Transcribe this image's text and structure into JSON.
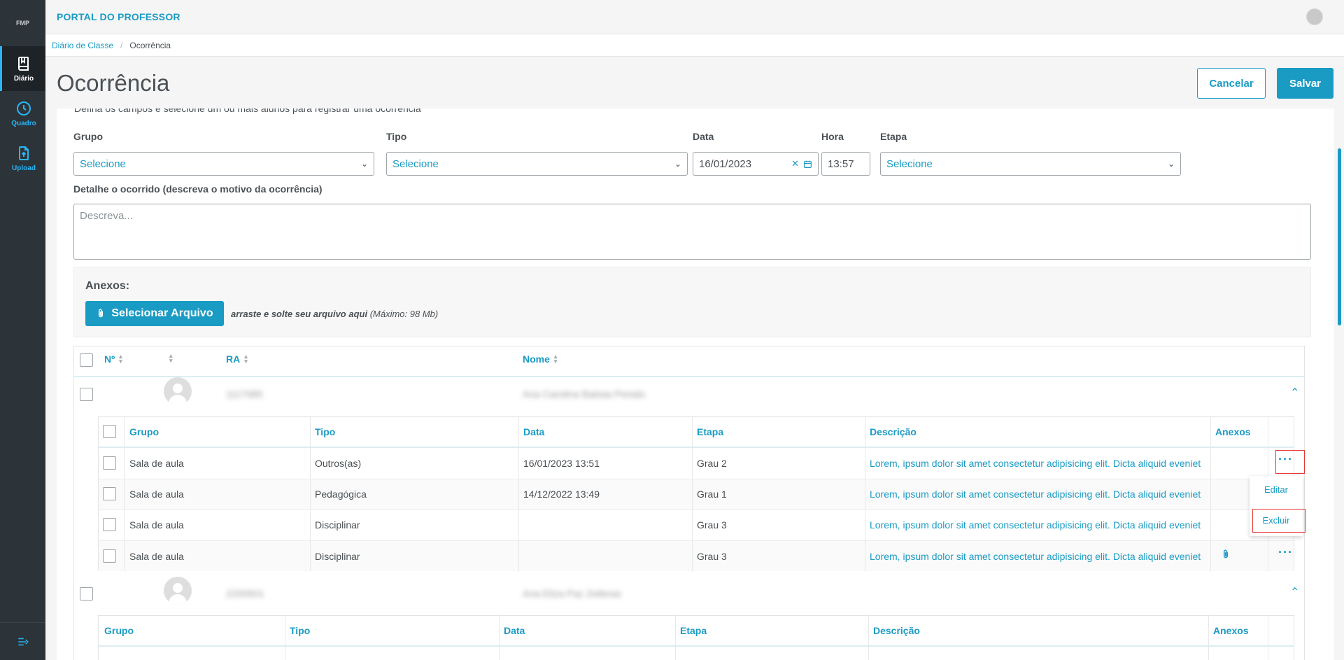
{
  "app": {
    "logo": "FMP",
    "title": "PORTAL DO PROFESSOR"
  },
  "sidebar": {
    "items": [
      {
        "label": "Diário",
        "icon": "book-icon"
      },
      {
        "label": "Quadro",
        "icon": "clock-icon"
      },
      {
        "label": "Upload",
        "icon": "upload-icon"
      }
    ]
  },
  "breadcrumb": {
    "parent": "Diário de Classe",
    "current": "Ocorrência"
  },
  "page": {
    "title": "Ocorrência",
    "cancel_label": "Cancelar",
    "save_label": "Salvar",
    "intro": "Defina os campos e selecione um ou mais alunos para registrar uma ocorrência"
  },
  "form": {
    "grupo_label": "Grupo",
    "grupo_value": "Selecione",
    "tipo_label": "Tipo",
    "tipo_value": "Selecione",
    "data_label": "Data",
    "data_value": "16/01/2023",
    "hora_label": "Hora",
    "hora_value": "13:57",
    "etapa_label": "Etapa",
    "etapa_value": "Selecione",
    "detalhe_label": "Detalhe o ocorrido (descreva o motivo da ocorrência)",
    "detalhe_placeholder": "Descreva..."
  },
  "attachments": {
    "label": "Anexos:",
    "button_label": "Selecionar Arquivo",
    "hint_bold": "arraste e solte seu arquivo aqui",
    "hint_rest": " (Máximo: 98 Mb)"
  },
  "students_table": {
    "headers": {
      "numero": "Nº",
      "ra": "RA",
      "nome": "Nome"
    },
    "students": [
      {
        "ra": "1117085",
        "nome": "Ana Carolina Batista Penido"
      },
      {
        "ra": "2200501",
        "nome": "Ana Eliza Paz Zelleras"
      }
    ]
  },
  "occurrences_table": {
    "headers": {
      "grupo": "Grupo",
      "tipo": "Tipo",
      "data": "Data",
      "etapa": "Etapa",
      "descricao": "Descrição",
      "anexos": "Anexos"
    },
    "rows": [
      {
        "grupo": "Sala de aula",
        "tipo": "Outros(as)",
        "data": "16/01/2023 13:51",
        "etapa": "Grau 2",
        "descricao": "Lorem, ipsum dolor sit amet consectetur adipisicing elit. Dicta aliquid eveniet"
      },
      {
        "grupo": "Sala de aula",
        "tipo": "Pedagógica",
        "data": "14/12/2022 13:49",
        "etapa": "Grau 1",
        "descricao": "Lorem, ipsum dolor sit amet consectetur adipisicing elit. Dicta aliquid eveniet"
      },
      {
        "grupo": "Sala de aula",
        "tipo": "Disciplinar",
        "data": "",
        "etapa": "Grau 3",
        "descricao": "Lorem, ipsum dolor sit amet consectetur adipisicing elit. Dicta aliquid eveniet"
      },
      {
        "grupo": "Sala de aula",
        "tipo": "Disciplinar",
        "data": "",
        "etapa": "Grau 3",
        "descricao": "Lorem, ipsum dolor sit amet consectetur adipisicing elit. Dicta aliquid eveniet"
      }
    ]
  },
  "row_menu": {
    "edit_label": "Editar",
    "delete_label": "Excluir"
  },
  "colors": {
    "accent": "#1a9bc4",
    "sidebar": "#2c3339",
    "highlight": "#e53935"
  }
}
